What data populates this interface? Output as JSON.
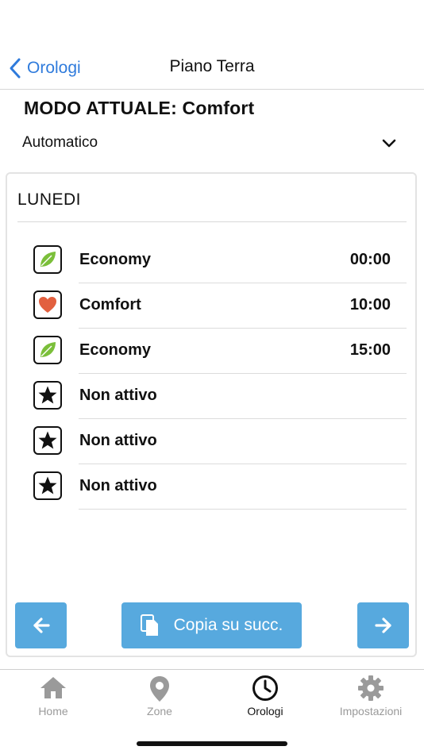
{
  "nav": {
    "back_label": "Orologi",
    "title": "Piano Terra"
  },
  "mode": {
    "title": "MODO ATTUALE: Comfort",
    "selected": "Automatico"
  },
  "schedule": {
    "day": "LUNEDI",
    "slots": [
      {
        "mode": "Economy",
        "time": "00:00",
        "icon": "leaf-icon"
      },
      {
        "mode": "Comfort",
        "time": "10:00",
        "icon": "heart-icon"
      },
      {
        "mode": "Economy",
        "time": "15:00",
        "icon": "leaf-icon"
      },
      {
        "mode": "Non attivo",
        "time": "",
        "icon": "star-icon"
      },
      {
        "mode": "Non attivo",
        "time": "",
        "icon": "star-icon"
      },
      {
        "mode": "Non attivo",
        "time": "",
        "icon": "star-icon"
      }
    ]
  },
  "actions": {
    "copy_label": "Copia su succ."
  },
  "tabbar": {
    "items": [
      {
        "label": "Home",
        "icon": "home-icon"
      },
      {
        "label": "Zone",
        "icon": "location-pin-icon"
      },
      {
        "label": "Orologi",
        "icon": "clock-icon"
      },
      {
        "label": "Impostazioni",
        "icon": "gear-icon"
      }
    ],
    "active": "Orologi"
  },
  "colors": {
    "accent": "#2f7bdc",
    "button": "#57a9de",
    "economy_leaf": "#7bbf3a",
    "comfort_heart": "#e2603f",
    "tab_inactive": "#9a9a9a"
  }
}
